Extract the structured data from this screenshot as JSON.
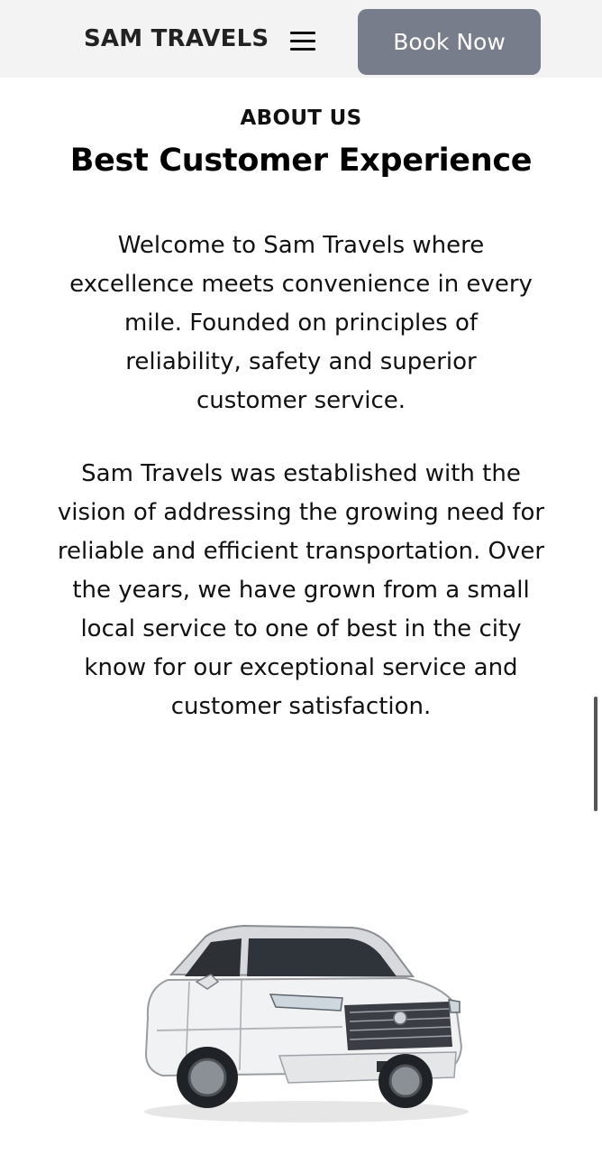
{
  "header": {
    "brand": "SAM TRAVELS",
    "menu_icon": "hamburger-menu-icon",
    "book_label": "Book Now"
  },
  "about": {
    "label": "ABOUT US",
    "title": "Best Customer Experience",
    "paragraph1": "Welcome to Sam Travels where excellence meets convenience in every mile. Founded on principles of reliability, safety and superior customer service.",
    "paragraph2": "Sam Travels was established with the vision of addressing the growing need for reliable and efficient transportation. Over the years, we have grown from a small local service to one of best in the city know for our exceptional service and customer satisfaction."
  },
  "colors": {
    "header_bg": "#f3f3f3",
    "button_bg": "#787d8b",
    "button_text": "#ffffff",
    "text": "#111111"
  },
  "images": {
    "car": "white-suv-car-image"
  }
}
